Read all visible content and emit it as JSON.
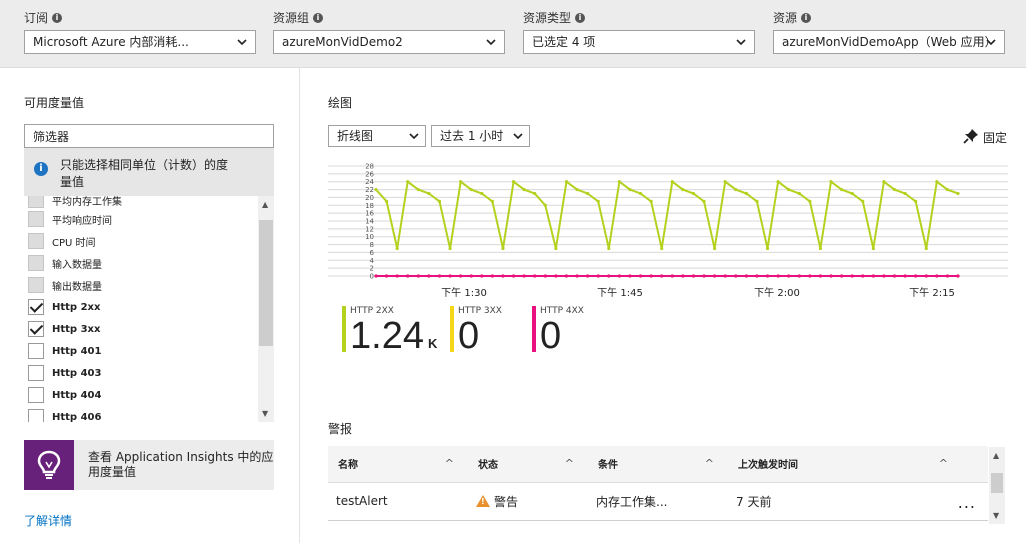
{
  "filters": [
    {
      "label": "订阅",
      "value": "Microsoft Azure 内部消耗..."
    },
    {
      "label": "资源组",
      "value": "azureMonVidDemo2"
    },
    {
      "label": "资源类型",
      "value": "已选定 4 项"
    },
    {
      "label": "资源",
      "value": "azureMonVidDemoApp（Web 应用）"
    }
  ],
  "metrics_panel": {
    "title": "可用度量值",
    "filter_value": "筛选器",
    "notice": "只能选择相同单位（计数）的度量值",
    "items": [
      {
        "label": "平均内存工作集",
        "checked": false,
        "disabled": true
      },
      {
        "label": "平均响应时间",
        "checked": false,
        "disabled": true
      },
      {
        "label": "CPU 时间",
        "checked": false,
        "disabled": true
      },
      {
        "label": "输入数据量",
        "checked": false,
        "disabled": true
      },
      {
        "label": "输出数据量",
        "checked": false,
        "disabled": true
      },
      {
        "label": "Http 2xx",
        "checked": true,
        "disabled": false
      },
      {
        "label": "Http 3xx",
        "checked": true,
        "disabled": false
      },
      {
        "label": "Http 401",
        "checked": false,
        "disabled": false
      },
      {
        "label": "Http 403",
        "checked": false,
        "disabled": false
      },
      {
        "label": "Http 404",
        "checked": false,
        "disabled": false
      },
      {
        "label": "Http 406",
        "checked": false,
        "disabled": false
      }
    ],
    "insights_text": "查看 Application Insights 中的应用度量值",
    "learn_more": "了解详情"
  },
  "chart_section": {
    "title": "绘图",
    "chart_type": "折线图",
    "time_range": "过去 1 小时",
    "pin_label": "固定"
  },
  "chart_data": {
    "type": "line",
    "x_tick_labels": [
      "下午 1:30",
      "下午 1:45",
      "下午 2:00",
      "下午 2:15"
    ],
    "ylim": [
      0,
      28
    ],
    "y_tick_labels": [
      "0",
      "2",
      "4",
      "6",
      "8",
      "10",
      "12",
      "14",
      "16",
      "18",
      "20",
      "22",
      "24",
      "26",
      "28"
    ],
    "grid": true,
    "series": [
      {
        "name": "HTTP 2XX",
        "color": "#b5d11f",
        "values": [
          22,
          19,
          7,
          24,
          22,
          21,
          19,
          7,
          24,
          22,
          21,
          19,
          7,
          24,
          22,
          21,
          18,
          7,
          24,
          22,
          21,
          19,
          7,
          24,
          22,
          21,
          19,
          7,
          24,
          22,
          21,
          19,
          7,
          24,
          22,
          21,
          19,
          7,
          24,
          22,
          21,
          19,
          7,
          24,
          22,
          21,
          19,
          7,
          24,
          22,
          21,
          19,
          7,
          24,
          22,
          21
        ]
      },
      {
        "name": "HTTP 3XX",
        "color": "#f5d619",
        "values": [
          0,
          0,
          0,
          0,
          0,
          0,
          0,
          0,
          0,
          0,
          0,
          0,
          0,
          0,
          0,
          0,
          0,
          0,
          0,
          0,
          0,
          0,
          0,
          0,
          0,
          0,
          0,
          0,
          0,
          0,
          0,
          0,
          0,
          0,
          0,
          0,
          0,
          0,
          0,
          0,
          0,
          0,
          0,
          0,
          0,
          0,
          0,
          0,
          0,
          0,
          0,
          0,
          0,
          0,
          0,
          0
        ]
      },
      {
        "name": "HTTP 4XX",
        "color": "#e8117f",
        "values": [
          0,
          0,
          0,
          0,
          0,
          0,
          0,
          0,
          0,
          0,
          0,
          0,
          0,
          0,
          0,
          0,
          0,
          0,
          0,
          0,
          0,
          0,
          0,
          0,
          0,
          0,
          0,
          0,
          0,
          0,
          0,
          0,
          0,
          0,
          0,
          0,
          0,
          0,
          0,
          0,
          0,
          0,
          0,
          0,
          0,
          0,
          0,
          0,
          0,
          0,
          0,
          0,
          0,
          0,
          0,
          0
        ]
      }
    ]
  },
  "tiles": [
    {
      "name": "HTTP 2XX",
      "value": "1.24",
      "unit": "K",
      "color": "#b5d11f"
    },
    {
      "name": "HTTP 3XX",
      "value": "0",
      "unit": "",
      "color": "#f5d619"
    },
    {
      "name": "HTTP 4XX",
      "value": "0",
      "unit": "",
      "color": "#e8117f"
    }
  ],
  "alerts": {
    "title": "警报",
    "columns": [
      "名称",
      "状态",
      "条件",
      "上次触发时间"
    ],
    "rows": [
      {
        "name": "testAlert",
        "status": "警告",
        "condition": "内存工作集...",
        "last_triggered": "7 天前",
        "more": "..."
      }
    ]
  }
}
